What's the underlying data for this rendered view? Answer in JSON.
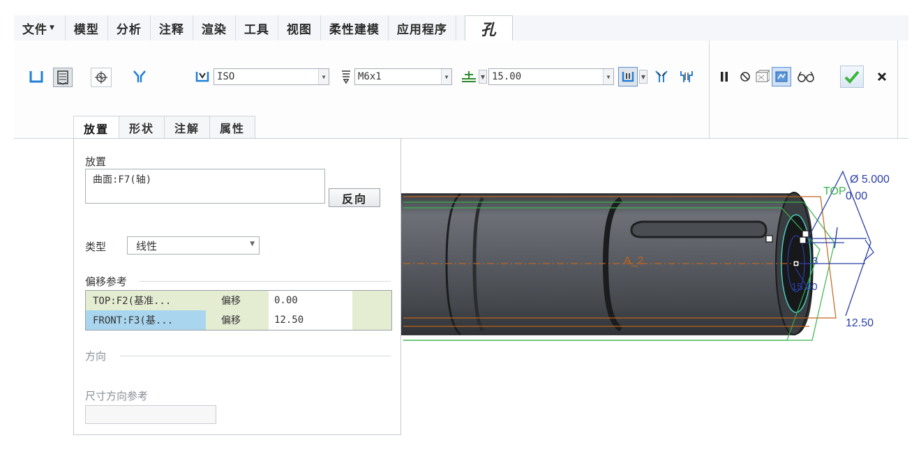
{
  "menu": {
    "file": "文件",
    "items": [
      "模型",
      "分析",
      "注释",
      "渲染",
      "工具",
      "视图",
      "柔性建模",
      "应用程序"
    ],
    "active_tab": "孔"
  },
  "dashboard": {
    "standard_value": "ISO",
    "screw_size_value": "M6x1",
    "depth_value": "15.00"
  },
  "subtabs": [
    "放置",
    "形状",
    "注解",
    "属性"
  ],
  "placement_panel": {
    "placement_label": "放置",
    "placement_reference": "曲面:F7(轴)",
    "flip_button": "反向",
    "type_label": "类型",
    "type_value": "线性",
    "offset_refs_label": "偏移参考",
    "offset_rows": [
      {
        "reference": "TOP:F2(基准...",
        "constraint": "偏移",
        "value": "0.00"
      },
      {
        "reference": "FRONT:F3(基...",
        "constraint": "偏移",
        "value": "12.50"
      }
    ],
    "direction_label": "方向",
    "dim_direction_label": "尺寸方向参考"
  },
  "graphics": {
    "diameter_dim": "Ø 5.000",
    "top_label": "TOP",
    "top_offset_dim": "0.00",
    "axis_label": "A_2",
    "depth_dim": "15.00",
    "front_offset_dim": "12.50",
    "small_dim": "3"
  },
  "colors": {
    "accent_green": "#3cb43c",
    "part_gray": "#55595f",
    "datum_green": "#37b24d",
    "axis_orange": "#c0651c",
    "dim_blue": "#2a3ea8",
    "selected_row": "#a9d6ee",
    "table_bg": "#e4ecd1"
  }
}
